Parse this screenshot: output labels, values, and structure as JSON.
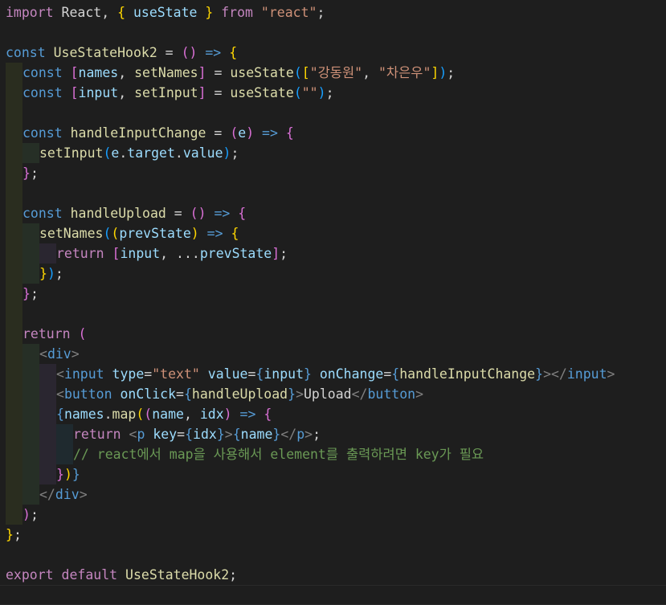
{
  "editor": {
    "language": "javascript-react",
    "indent_colors": [
      "#2a2d1f",
      "#262f26",
      "#2a2630",
      "#1f2a2f",
      "#2d2a22"
    ],
    "active_line": 29,
    "lines": [
      {
        "indent": 0,
        "tokens": [
          [
            "import",
            "#c586c0"
          ],
          [
            " React, ",
            "#d4d4d4"
          ],
          [
            "{",
            "#ffd700"
          ],
          [
            " useState ",
            "#9cdcfe"
          ],
          [
            "}",
            "#ffd700"
          ],
          [
            " from ",
            "#c586c0"
          ],
          [
            "\"react\"",
            "#ce9178"
          ],
          [
            ";",
            "#d4d4d4"
          ]
        ]
      },
      {
        "indent": 0,
        "tokens": []
      },
      {
        "indent": 0,
        "tokens": [
          [
            "const",
            "#569cd6"
          ],
          [
            " ",
            "#d4d4d4"
          ],
          [
            "UseStateHook2",
            "#dcdcaa"
          ],
          [
            " = ",
            "#d4d4d4"
          ],
          [
            "()",
            "#da70d6"
          ],
          [
            " => ",
            "#569cd6"
          ],
          [
            "{",
            "#ffd700"
          ]
        ]
      },
      {
        "indent": 1,
        "tokens": [
          [
            "const",
            "#569cd6"
          ],
          [
            " ",
            "#d4d4d4"
          ],
          [
            "[",
            "#da70d6"
          ],
          [
            "names",
            "#9cdcfe"
          ],
          [
            ", ",
            "#d4d4d4"
          ],
          [
            "setNames",
            "#dcdcaa"
          ],
          [
            "]",
            "#da70d6"
          ],
          [
            " = ",
            "#d4d4d4"
          ],
          [
            "useState",
            "#dcdcaa"
          ],
          [
            "(",
            "#179fff"
          ],
          [
            "[",
            "#ffd700"
          ],
          [
            "\"강동원\"",
            "#ce9178"
          ],
          [
            ", ",
            "#d4d4d4"
          ],
          [
            "\"차은우\"",
            "#ce9178"
          ],
          [
            "]",
            "#ffd700"
          ],
          [
            ")",
            "#179fff"
          ],
          [
            ";",
            "#d4d4d4"
          ]
        ]
      },
      {
        "indent": 1,
        "tokens": [
          [
            "const",
            "#569cd6"
          ],
          [
            " ",
            "#d4d4d4"
          ],
          [
            "[",
            "#da70d6"
          ],
          [
            "input",
            "#9cdcfe"
          ],
          [
            ", ",
            "#d4d4d4"
          ],
          [
            "setInput",
            "#dcdcaa"
          ],
          [
            "]",
            "#da70d6"
          ],
          [
            " = ",
            "#d4d4d4"
          ],
          [
            "useState",
            "#dcdcaa"
          ],
          [
            "(",
            "#179fff"
          ],
          [
            "\"\"",
            "#ce9178"
          ],
          [
            ")",
            "#179fff"
          ],
          [
            ";",
            "#d4d4d4"
          ]
        ]
      },
      {
        "indent": 1,
        "tokens": []
      },
      {
        "indent": 1,
        "tokens": [
          [
            "const",
            "#569cd6"
          ],
          [
            " ",
            "#d4d4d4"
          ],
          [
            "handleInputChange",
            "#dcdcaa"
          ],
          [
            " = ",
            "#d4d4d4"
          ],
          [
            "(",
            "#da70d6"
          ],
          [
            "e",
            "#9cdcfe"
          ],
          [
            ")",
            "#da70d6"
          ],
          [
            " => ",
            "#569cd6"
          ],
          [
            "{",
            "#da70d6"
          ]
        ]
      },
      {
        "indent": 2,
        "tokens": [
          [
            "setInput",
            "#dcdcaa"
          ],
          [
            "(",
            "#179fff"
          ],
          [
            "e",
            "#9cdcfe"
          ],
          [
            ".",
            "#d4d4d4"
          ],
          [
            "target",
            "#9cdcfe"
          ],
          [
            ".",
            "#d4d4d4"
          ],
          [
            "value",
            "#9cdcfe"
          ],
          [
            ")",
            "#179fff"
          ],
          [
            ";",
            "#d4d4d4"
          ]
        ]
      },
      {
        "indent": 1,
        "tokens": [
          [
            "}",
            "#da70d6"
          ],
          [
            ";",
            "#d4d4d4"
          ]
        ]
      },
      {
        "indent": 1,
        "tokens": []
      },
      {
        "indent": 1,
        "tokens": [
          [
            "const",
            "#569cd6"
          ],
          [
            " ",
            "#d4d4d4"
          ],
          [
            "handleUpload",
            "#dcdcaa"
          ],
          [
            " = ",
            "#d4d4d4"
          ],
          [
            "()",
            "#da70d6"
          ],
          [
            " => ",
            "#569cd6"
          ],
          [
            "{",
            "#da70d6"
          ]
        ]
      },
      {
        "indent": 2,
        "tokens": [
          [
            "setNames",
            "#dcdcaa"
          ],
          [
            "(",
            "#179fff"
          ],
          [
            "(",
            "#ffd700"
          ],
          [
            "prevState",
            "#9cdcfe"
          ],
          [
            ")",
            "#ffd700"
          ],
          [
            " => ",
            "#569cd6"
          ],
          [
            "{",
            "#ffd700"
          ]
        ]
      },
      {
        "indent": 3,
        "tokens": [
          [
            "return",
            "#c586c0"
          ],
          [
            " ",
            "#d4d4d4"
          ],
          [
            "[",
            "#da70d6"
          ],
          [
            "input",
            "#9cdcfe"
          ],
          [
            ", ...",
            "#d4d4d4"
          ],
          [
            "prevState",
            "#9cdcfe"
          ],
          [
            "]",
            "#da70d6"
          ],
          [
            ";",
            "#d4d4d4"
          ]
        ]
      },
      {
        "indent": 2,
        "tokens": [
          [
            "}",
            "#ffd700"
          ],
          [
            ")",
            "#179fff"
          ],
          [
            ";",
            "#d4d4d4"
          ]
        ]
      },
      {
        "indent": 1,
        "tokens": [
          [
            "}",
            "#da70d6"
          ],
          [
            ";",
            "#d4d4d4"
          ]
        ]
      },
      {
        "indent": 1,
        "tokens": []
      },
      {
        "indent": 1,
        "tokens": [
          [
            "return",
            "#c586c0"
          ],
          [
            " ",
            "#d4d4d4"
          ],
          [
            "(",
            "#da70d6"
          ]
        ]
      },
      {
        "indent": 2,
        "tokens": [
          [
            "<",
            "#808080"
          ],
          [
            "div",
            "#569cd6"
          ],
          [
            ">",
            "#808080"
          ]
        ]
      },
      {
        "indent": 3,
        "tokens": [
          [
            "<",
            "#808080"
          ],
          [
            "input",
            "#569cd6"
          ],
          [
            " ",
            "#d4d4d4"
          ],
          [
            "type",
            "#9cdcfe"
          ],
          [
            "=",
            "#d4d4d4"
          ],
          [
            "\"text\"",
            "#ce9178"
          ],
          [
            " ",
            "#d4d4d4"
          ],
          [
            "value",
            "#9cdcfe"
          ],
          [
            "=",
            "#d4d4d4"
          ],
          [
            "{",
            "#569cd6"
          ],
          [
            "input",
            "#9cdcfe"
          ],
          [
            "}",
            "#569cd6"
          ],
          [
            " ",
            "#d4d4d4"
          ],
          [
            "onChange",
            "#9cdcfe"
          ],
          [
            "=",
            "#d4d4d4"
          ],
          [
            "{",
            "#569cd6"
          ],
          [
            "handleInputChange",
            "#dcdcaa"
          ],
          [
            "}",
            "#569cd6"
          ],
          [
            "></",
            "#808080"
          ],
          [
            "input",
            "#569cd6"
          ],
          [
            ">",
            "#808080"
          ]
        ]
      },
      {
        "indent": 3,
        "tokens": [
          [
            "<",
            "#808080"
          ],
          [
            "button",
            "#569cd6"
          ],
          [
            " ",
            "#d4d4d4"
          ],
          [
            "onClick",
            "#9cdcfe"
          ],
          [
            "=",
            "#d4d4d4"
          ],
          [
            "{",
            "#569cd6"
          ],
          [
            "handleUpload",
            "#dcdcaa"
          ],
          [
            "}",
            "#569cd6"
          ],
          [
            ">",
            "#808080"
          ],
          [
            "Upload",
            "#d4d4d4"
          ],
          [
            "</",
            "#808080"
          ],
          [
            "button",
            "#569cd6"
          ],
          [
            ">",
            "#808080"
          ]
        ]
      },
      {
        "indent": 3,
        "tokens": [
          [
            "{",
            "#569cd6"
          ],
          [
            "names",
            "#9cdcfe"
          ],
          [
            ".",
            "#d4d4d4"
          ],
          [
            "map",
            "#dcdcaa"
          ],
          [
            "(",
            "#ffd700"
          ],
          [
            "(",
            "#da70d6"
          ],
          [
            "name",
            "#9cdcfe"
          ],
          [
            ", ",
            "#d4d4d4"
          ],
          [
            "idx",
            "#9cdcfe"
          ],
          [
            ")",
            "#da70d6"
          ],
          [
            " => ",
            "#569cd6"
          ],
          [
            "{",
            "#da70d6"
          ]
        ]
      },
      {
        "indent": 4,
        "tokens": [
          [
            "return",
            "#c586c0"
          ],
          [
            " ",
            "#d4d4d4"
          ],
          [
            "<",
            "#808080"
          ],
          [
            "p",
            "#569cd6"
          ],
          [
            " ",
            "#d4d4d4"
          ],
          [
            "key",
            "#9cdcfe"
          ],
          [
            "=",
            "#d4d4d4"
          ],
          [
            "{",
            "#569cd6"
          ],
          [
            "idx",
            "#9cdcfe"
          ],
          [
            "}",
            "#569cd6"
          ],
          [
            ">",
            "#808080"
          ],
          [
            "{",
            "#569cd6"
          ],
          [
            "name",
            "#9cdcfe"
          ],
          [
            "}",
            "#569cd6"
          ],
          [
            "</",
            "#808080"
          ],
          [
            "p",
            "#569cd6"
          ],
          [
            ">",
            "#808080"
          ],
          [
            ";",
            "#d4d4d4"
          ]
        ]
      },
      {
        "indent": 4,
        "tokens": [
          [
            "// react에서 map을 사용해서 element를 출력하려면 key가 필요",
            "#6a9955"
          ]
        ]
      },
      {
        "indent": 3,
        "tokens": [
          [
            "}",
            "#da70d6"
          ],
          [
            ")",
            "#ffd700"
          ],
          [
            "}",
            "#569cd6"
          ]
        ]
      },
      {
        "indent": 2,
        "tokens": [
          [
            "</",
            "#808080"
          ],
          [
            "div",
            "#569cd6"
          ],
          [
            ">",
            "#808080"
          ]
        ]
      },
      {
        "indent": 1,
        "tokens": [
          [
            ")",
            "#da70d6"
          ],
          [
            ";",
            "#d4d4d4"
          ]
        ]
      },
      {
        "indent": 0,
        "tokens": [
          [
            "}",
            "#ffd700"
          ],
          [
            ";",
            "#d4d4d4"
          ]
        ]
      },
      {
        "indent": 0,
        "tokens": []
      },
      {
        "indent": 0,
        "tokens": [
          [
            "export",
            "#c586c0"
          ],
          [
            " ",
            "#d4d4d4"
          ],
          [
            "default",
            "#c586c0"
          ],
          [
            " ",
            "#d4d4d4"
          ],
          [
            "UseStateHook2",
            "#dcdcaa"
          ],
          [
            ";",
            "#d4d4d4"
          ]
        ]
      },
      {
        "indent": 0,
        "tokens": []
      }
    ]
  }
}
